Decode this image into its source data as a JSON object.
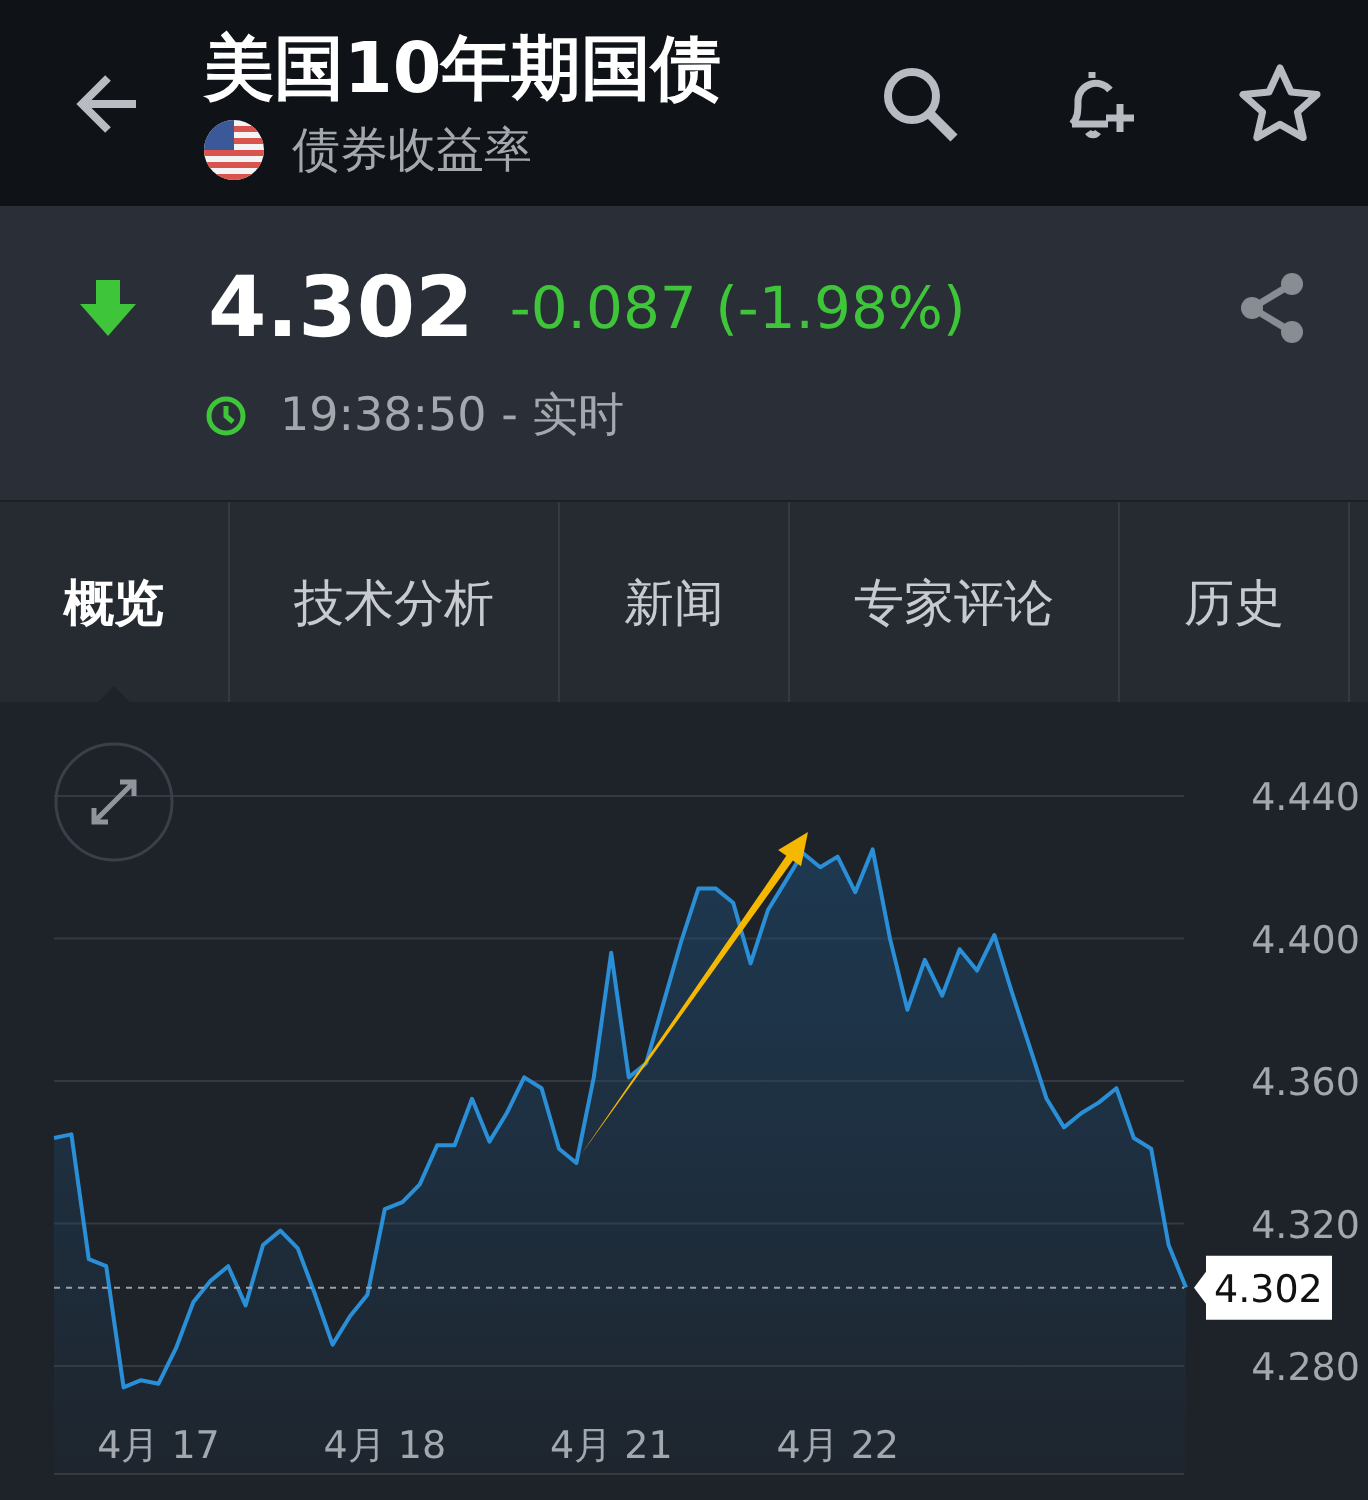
{
  "header": {
    "title": "美国10年期国债",
    "subtitle": "债券收益率"
  },
  "quote": {
    "price": "4.302",
    "falling": true,
    "change": "-0.087 (-1.98%)",
    "time": "19:38:50 - 实时"
  },
  "tabs": [
    {
      "label": "概览",
      "selected": true
    },
    {
      "label": "技术分析",
      "selected": false
    },
    {
      "label": "新闻",
      "selected": false
    },
    {
      "label": "专家评论",
      "selected": false
    },
    {
      "label": "历史",
      "selected": false
    }
  ],
  "chart": {
    "chart_data": {
      "type": "area",
      "categories": [
        null,
        null,
        null,
        null,
        null,
        null,
        "4月 17",
        null,
        null,
        null,
        null,
        null,
        null,
        null,
        null,
        null,
        null,
        null,
        null,
        "4月 18",
        null,
        null,
        null,
        null,
        null,
        null,
        null,
        null,
        null,
        null,
        null,
        null,
        "4月 21",
        null,
        null,
        null,
        null,
        null,
        null,
        null,
        null,
        null,
        null,
        null,
        null,
        "4月 22",
        null,
        null,
        null,
        null,
        null,
        null,
        null,
        null,
        null,
        null,
        null,
        null,
        null,
        null,
        null,
        null,
        null,
        null,
        null,
        null
      ],
      "series": [
        {
          "color": "#2a8fd6",
          "values": [
            4.344,
            4.345,
            4.31,
            4.308,
            4.274,
            4.276,
            4.275,
            4.285,
            4.298,
            4.304,
            4.308,
            4.297,
            4.314,
            4.318,
            4.313,
            4.3,
            4.286,
            4.294,
            4.3,
            4.324,
            4.326,
            4.331,
            4.342,
            4.342,
            4.355,
            4.343,
            4.351,
            4.361,
            4.358,
            4.341,
            4.337,
            4.361,
            4.396,
            4.361,
            4.365,
            4.382,
            4.399,
            4.414,
            4.414,
            4.41,
            4.393,
            4.408,
            4.416,
            4.424,
            4.42,
            4.423,
            4.413,
            4.425,
            4.4,
            4.38,
            4.394,
            4.384,
            4.397,
            4.391,
            4.401,
            4.385,
            4.37,
            4.355,
            4.347,
            4.351,
            4.354,
            4.358,
            4.344,
            4.341,
            4.314,
            4.302
          ]
        }
      ],
      "grid": true,
      "ylim": [
        4.2497,
        4.44
      ],
      "yticks": [
        {
          "value": 4.44,
          "label": "4.440"
        },
        {
          "value": 4.4,
          "label": "4.400"
        },
        {
          "value": 4.36,
          "label": "4.360"
        },
        {
          "value": 4.32,
          "label": "4.320"
        },
        {
          "value": 4.28,
          "label": "4.280"
        }
      ],
      "ref_lines": [
        {
          "axis": "y",
          "value": 4.302,
          "label": "4.302",
          "color": "#9aa0a8"
        }
      ]
    }
  }
}
